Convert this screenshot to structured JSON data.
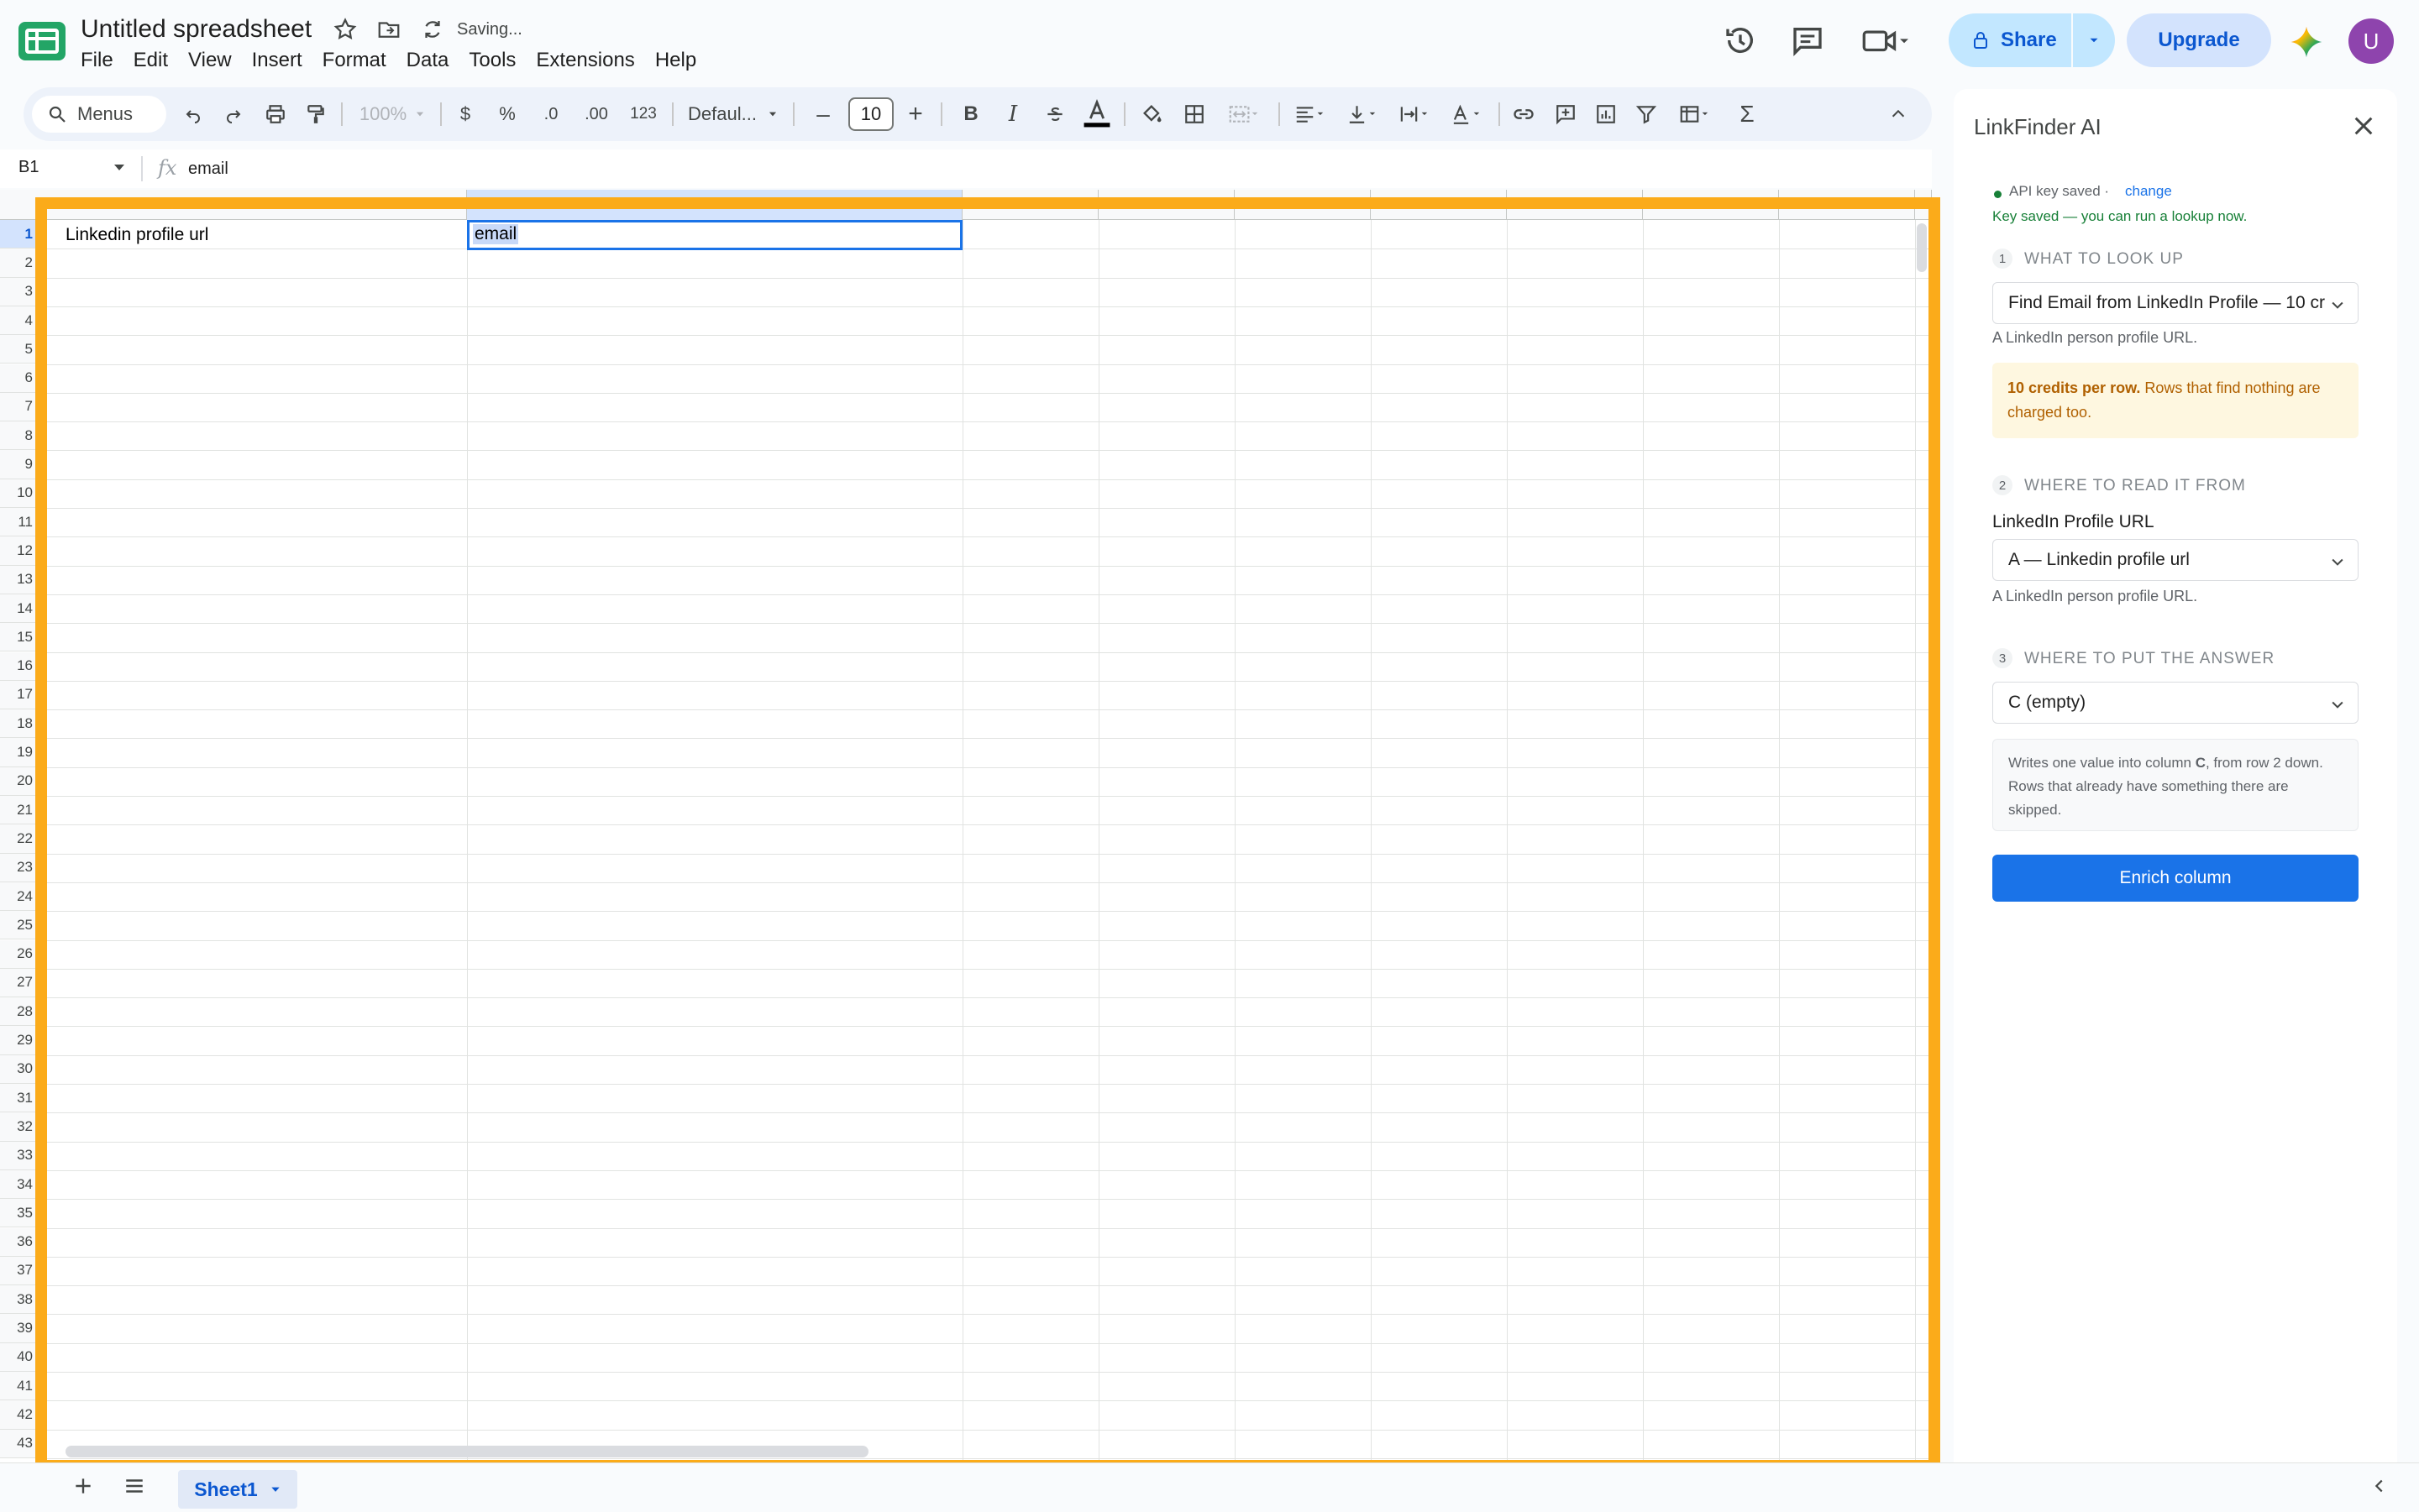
{
  "app": {
    "doc_title": "Untitled spreadsheet",
    "saving_status": "Saving...",
    "menus": [
      "File",
      "Edit",
      "View",
      "Insert",
      "Format",
      "Data",
      "Tools",
      "Extensions",
      "Help"
    ],
    "share_label": "Share",
    "upgrade_label": "Upgrade",
    "avatar_initial": "U"
  },
  "toolbar": {
    "menus_label": "Menus",
    "zoom": "100%",
    "currency": "$",
    "percent": "%",
    "dec_decrease": ".0",
    "dec_increase": ".00",
    "number_format": "123",
    "font": "Defaul...",
    "font_size": "10",
    "minus": "–",
    "plus": "+",
    "bold": "B",
    "italic": "I",
    "sum": "Σ"
  },
  "formula_bar": {
    "cell_ref": "B1",
    "fx": "fx",
    "value": "email"
  },
  "sheet": {
    "rows": [
      "1",
      "2",
      "3",
      "4",
      "5",
      "6",
      "7",
      "8",
      "9",
      "10",
      "11",
      "12",
      "13",
      "14",
      "15",
      "16",
      "17",
      "18",
      "19",
      "20",
      "21",
      "22",
      "23",
      "24",
      "25",
      "26",
      "27",
      "28",
      "29",
      "30",
      "31",
      "32",
      "33",
      "34",
      "35",
      "36",
      "37",
      "38",
      "39",
      "40",
      "41",
      "42",
      "43"
    ],
    "a1": "Linkedin profile url",
    "b1": "email",
    "tab_name": "Sheet1"
  },
  "panel": {
    "title": "LinkFinder AI",
    "api_status": "API key saved ·",
    "change_link": "change",
    "key_saved_msg": "Key saved — you can run a lookup now.",
    "step1_num": "1",
    "step1_label": "WHAT TO LOOK UP",
    "step1_select": "Find Email from LinkedIn Profile — 10 cr",
    "step1_hint": "A LinkedIn person profile URL.",
    "credits_bold": "10 credits per row.",
    "credits_rest": " Rows that find nothing are charged too.",
    "step2_num": "2",
    "step2_label": "WHERE TO READ IT FROM",
    "field_label": "LinkedIn Profile URL",
    "step2_select": "A — Linkedin profile url",
    "step2_hint": "A LinkedIn person profile URL.",
    "step3_num": "3",
    "step3_label": "WHERE TO PUT THE ANSWER",
    "step3_select": "C (empty)",
    "info_pre": "Writes one value into column ",
    "info_col": "C",
    "info_post": ", from row 2 down. Rows that already have something there are skipped.",
    "enrich_label": "Enrich column"
  },
  "colors": {
    "accent": "#1a73e8",
    "highlight": "#fbab1a",
    "share_bg": "#c2e7ff",
    "warn_text": "#b06000",
    "success": "#188038"
  }
}
